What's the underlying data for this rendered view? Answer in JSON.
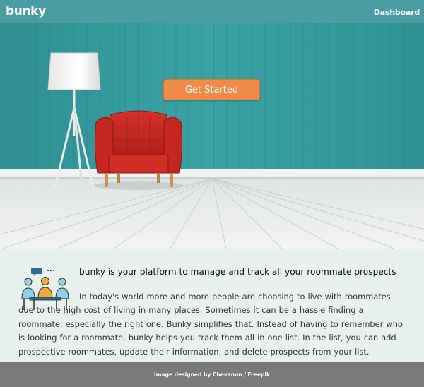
{
  "navbar": {
    "brand": "bunky",
    "dashboard_link": "Dashboard"
  },
  "hero": {
    "cta_label": "Get Started",
    "image": "teal wall with white floor lamp and red armchair"
  },
  "info": {
    "icon": "roommates-meeting-icon",
    "heading": "bunky is your platform to manage and track all your roommate prospects",
    "body": "In today's world more and more people are choosing to live with roommates due to the high cost of living in many places. Sometimes it can be a hassle finding a roommate, especially the right one. Bunky simplifies that. Instead of having to remember who is looking for a roommate, bunky helps you track them all in one list. In the list, you can add prospective roommates, update their information, and delete prospects from your list."
  },
  "footer": {
    "credit": "Image designed by Chevanon / Freepik"
  },
  "colors": {
    "navbar": "#4a9ea3",
    "cta": "#ef8a48",
    "info_bg": "#e9f1ef",
    "footer": "#7a7a7a"
  }
}
